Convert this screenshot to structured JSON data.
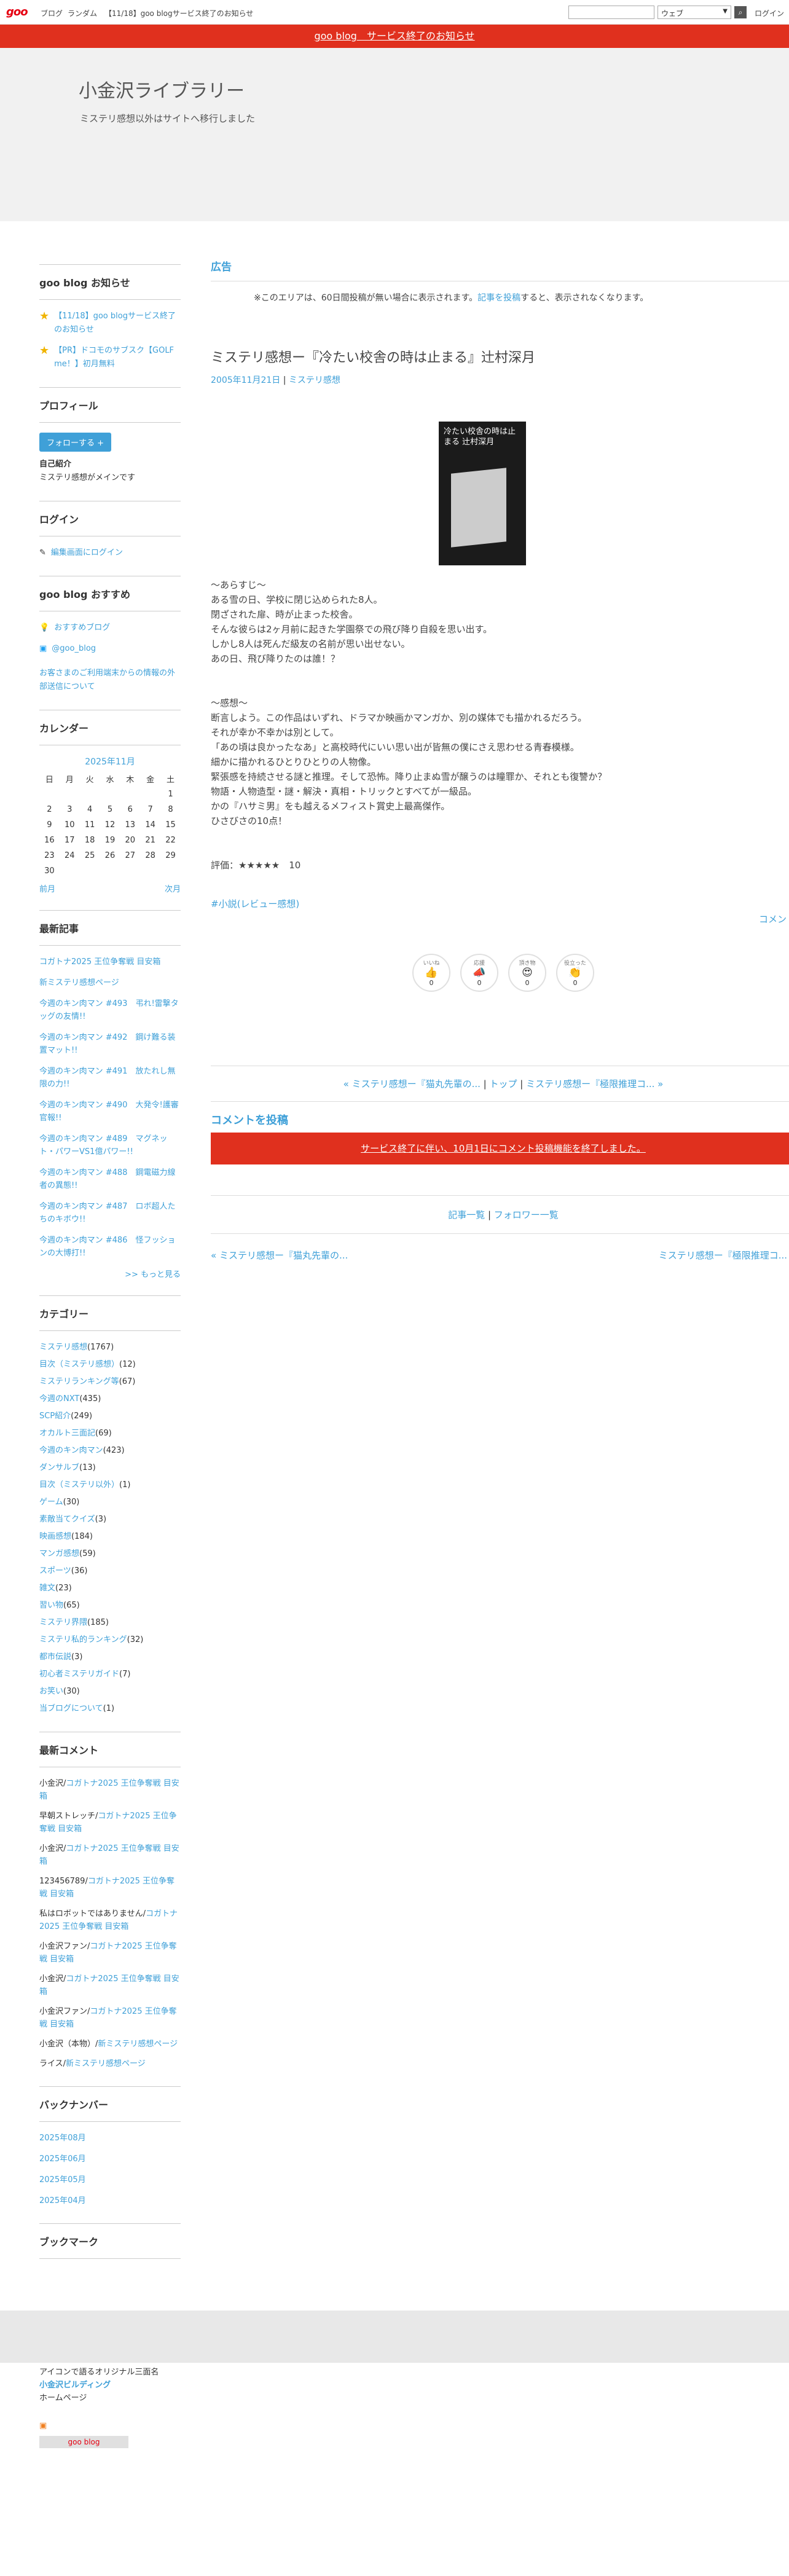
{
  "topbar": {
    "logo": "goo",
    "nav": [
      "ブログ",
      "ランダム",
      "【11/18】goo blogサービス終了のお知らせ"
    ],
    "scope": "ウェブ",
    "login": "ログイン"
  },
  "notice": "goo blog　サービス終了のお知らせ",
  "blog": {
    "name": "小金沢ライブラリー",
    "description": "ミステリ感想以外はサイトへ移行しました"
  },
  "sidebar": {
    "news": {
      "title": "goo blog お知らせ",
      "items": [
        "【11/18】goo blogサービス終了のお知らせ",
        "【PR】ドコモのサブスク【GOLF me！】初月無料"
      ]
    },
    "profile": {
      "title": "プロフィール",
      "follow": "フォローする",
      "intro_label": "自己紹介",
      "intro": "ミステリ感想がメインです"
    },
    "login": {
      "title": "ログイン",
      "edit": "編集画面にログイン"
    },
    "recommend": {
      "title": "goo blog おすすめ",
      "items": [
        "おすすめブログ",
        "@goo_blog"
      ],
      "note": "お客さまのご利用端末からの情報の外部送信について"
    },
    "calendar": {
      "title": "カレンダー",
      "month": "2025年11月",
      "weekdays": [
        "日",
        "月",
        "火",
        "水",
        "木",
        "金",
        "土"
      ],
      "weeks": [
        [
          "",
          "",
          "",
          "",
          "",
          "",
          "1"
        ],
        [
          "2",
          "3",
          "4",
          "5",
          "6",
          "7",
          "8"
        ],
        [
          "9",
          "10",
          "11",
          "12",
          "13",
          "14",
          "15"
        ],
        [
          "16",
          "17",
          "18",
          "19",
          "20",
          "21",
          "22"
        ],
        [
          "23",
          "24",
          "25",
          "26",
          "27",
          "28",
          "29"
        ],
        [
          "30",
          "",
          "",
          "",
          "",
          "",
          ""
        ]
      ],
      "prev": "前月",
      "next": "次月"
    },
    "recent": {
      "title": "最新記事",
      "items": [
        "コガトナ2025 王位争奪戦 目安箱",
        "新ミステリ感想ページ",
        "今週のキン肉マン #493　弔れ!雷撃タッグの友情!!",
        "今週のキン肉マン #492　鋼け難る装置マット!!",
        "今週のキン肉マン #491　放たれし無限の力!!",
        "今週のキン肉マン #490　大発令!護審官報!!",
        "今週のキン肉マン #489　マグネット・パワーVS1億パワー!!",
        "今週のキン肉マン #488　鋼電磁力線者の異態!!",
        "今週のキン肉マン #487　ロボ超人たちのキボウ!!",
        "今週のキン肉マン #486　怪フッションの大博打!!"
      ],
      "more": ">> もっと見る"
    },
    "categories": {
      "title": "カテゴリー",
      "items": [
        {
          "name": "ミステリ感想",
          "count": "(1767)"
        },
        {
          "name": "目次（ミステリ感想）",
          "count": "(12)"
        },
        {
          "name": "ミステリランキング等",
          "count": "(67)"
        },
        {
          "name": "今週のNXT",
          "count": "(435)"
        },
        {
          "name": "SCP紹介",
          "count": "(249)"
        },
        {
          "name": "オカルト三面記",
          "count": "(69)"
        },
        {
          "name": "今週のキン肉マン",
          "count": "(423)"
        },
        {
          "name": "ダンサルブ",
          "count": "(13)"
        },
        {
          "name": "目次（ミステリ以外）",
          "count": "(1)"
        },
        {
          "name": "ゲーム",
          "count": "(30)"
        },
        {
          "name": "素敵当てクイズ",
          "count": "(3)"
        },
        {
          "name": "映画感想",
          "count": "(184)"
        },
        {
          "name": "マンガ感想",
          "count": "(59)"
        },
        {
          "name": "スポーツ",
          "count": "(36)"
        },
        {
          "name": "雑文",
          "count": "(23)"
        },
        {
          "name": "習い物",
          "count": "(65)"
        },
        {
          "name": "ミステリ界隈",
          "count": "(185)"
        },
        {
          "name": "ミステリ私的ランキング",
          "count": "(32)"
        },
        {
          "name": "都市伝説",
          "count": "(3)"
        },
        {
          "name": "初心者ミステリガイド",
          "count": "(7)"
        },
        {
          "name": "お笑い",
          "count": "(30)"
        },
        {
          "name": "当ブログについて",
          "count": "(1)"
        }
      ]
    },
    "comments": {
      "title": "最新コメント",
      "items": [
        {
          "who": "小金沢/",
          "link": "コガトナ2025 王位争奪戦 目安箱"
        },
        {
          "who": "早朝ストレッチ/",
          "link": "コガトナ2025 王位争奪戦 目安箱"
        },
        {
          "who": "小金沢/",
          "link": "コガトナ2025 王位争奪戦 目安箱"
        },
        {
          "who": "123456789/",
          "link": "コガトナ2025 王位争奪戦 目安箱"
        },
        {
          "who": "私はロボットではありません/",
          "link": "コガトナ2025 王位争奪戦 目安箱"
        },
        {
          "who": "小金沢ファン/",
          "link": "コガトナ2025 王位争奪戦 目安箱"
        },
        {
          "who": "小金沢/",
          "link": "コガトナ2025 王位争奪戦 目安箱"
        },
        {
          "who": "小金沢ファン/",
          "link": "コガトナ2025 王位争奪戦 目安箱"
        },
        {
          "who": "小金沢（本物）/",
          "link": "新ミステリ感想ページ"
        },
        {
          "who": "ライス/",
          "link": "新ミステリ感想ページ"
        }
      ]
    },
    "backnumber": {
      "title": "バックナンバー",
      "items": [
        "2025年08月",
        "2025年06月",
        "2025年05月",
        "2025年04月"
      ]
    },
    "bookmark": {
      "title": "ブックマーク",
      "items": [
        "アイコンで語るオリジナル三面名",
        "小金沢ビルディング",
        "ホームページ"
      ],
      "badge": "goo blog"
    }
  },
  "main": {
    "ad": {
      "title": "広告",
      "text_before": "※このエリアは、60日間投稿が無い場合に表示されます。",
      "link": "記事を投稿",
      "text_after": "すると、表示されなくなります。"
    },
    "post": {
      "title": "ミステリ感想ー『冷たい校舎の時は止まる』辻村深月",
      "date": "2005年11月21日",
      "sep": " | ",
      "category": "ミステリ感想",
      "cover": "冷たい校舎の時は止まる 辻村深月",
      "body": [
        "〜あらすじ〜",
        "ある雪の日、学校に閉じ込められた8人。",
        "閉ざされた扉、時が止まった校舎。",
        "そんな彼らは2ヶ月前に起きた学園祭での飛び降り自殺を思い出す。",
        "しかし8人は死んだ級友の名前が思い出せない。",
        "あの日、飛び降りたのは誰！？",
        "",
        "",
        "〜感想〜",
        "断言しよう。この作品はいずれ、ドラマか映画かマンガか、別の媒体でも描かれるだろう。",
        "それが幸か不幸かは別として。",
        "「あの頃は良かったなあ」と高校時代にいい思い出が皆無の僕にさえ思わせる青春模様。",
        "細かに描かれるひとりひとりの人物像。",
        "緊張感を持続させる謎と推理。そして恐怖。降り止まぬ雪が醸うのは瞳罪か、それとも復讐か？",
        "物語・人物造型・謎・解決・真相・トリックとすべてが一級品。",
        "かの『ハサミ男』をも越えるメフィスト賞史上最高傑作。",
        "ひさびさの10点！",
        "",
        "",
        "評価：★★★★★　10"
      ],
      "tag": "#小説(レビュー感想)",
      "comment_link": "コメント",
      "reactions": [
        {
          "label": "いいね",
          "icon": "👍",
          "count": "0"
        },
        {
          "label": "応援",
          "icon": "📣",
          "count": "0"
        },
        {
          "label": "頂き物",
          "icon": "😍",
          "count": "0"
        },
        {
          "label": "役立った",
          "icon": "👏",
          "count": "0"
        }
      ]
    },
    "nav": {
      "prev": "« ミステリ感想ー『猫丸先輩の...','top':'トップ'",
      "top": "トップ",
      "next": "ミステリ感想ー『極限推理コ... »",
      "prev_label": "« ミステリ感想ー『猫丸先輩の...",
      "sep": " | "
    },
    "comment": {
      "title": "コメントを投稿",
      "closed": "サービス終了に伴い、10月1日にコメント投稿機能を終了しました。"
    },
    "footer_links": [
      "記事一覧",
      "フォロワー一覧"
    ],
    "bottom_nav": {
      "prev": "« ミステリ感想ー『猫丸先輩の...",
      "next": "ミステリ感想ー『極限推理コ... »"
    }
  }
}
